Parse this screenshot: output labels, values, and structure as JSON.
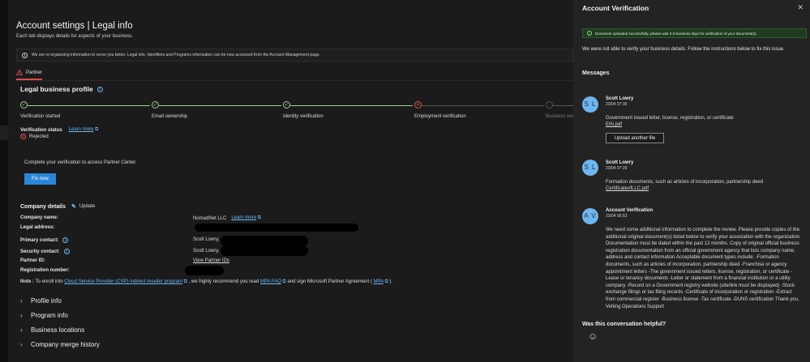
{
  "page": {
    "title": "Account settings | Legal info",
    "subtitle": "Each tab displays details for aspects of your business.",
    "banner": "We are re-organizing information to serve you better. Legal info, Identifiers and Programs information can be now accessed from the Account Management page.",
    "tab": "Partner"
  },
  "profile": {
    "title": "Legal business profile",
    "steps": [
      {
        "label": "Verification started",
        "state": "done"
      },
      {
        "label": "Email ownership",
        "state": "done"
      },
      {
        "label": "Identity verification",
        "state": "done"
      },
      {
        "label": "Employment verification",
        "state": "failed"
      },
      {
        "label": "Business veri",
        "state": "pending"
      }
    ],
    "status_label": "Verification status",
    "learn_more": "Learn more",
    "status_value": "Rejected",
    "complete_text": "Complete your verification to access Partner Center",
    "fix_button": "Fix now"
  },
  "company": {
    "title": "Company details",
    "update": "Update",
    "rows": {
      "name_label": "Company name:",
      "name_value": "NomadNet LLC",
      "name_link": "Learn more",
      "address_label": "Legal address:",
      "primary_label": "Primary contact:",
      "primary_value": "Scott Lowry,",
      "security_label": "Security contact:",
      "security_value": "Scott Lowry,",
      "partner_label": "Partner ID:",
      "partner_link": "View Partner IDs",
      "registration_label": "Registration number:"
    },
    "note": {
      "prefix": "Note :",
      "text1": " To enroll into ",
      "link1": "Cloud Service Provider (CSP) indirect reseller program",
      "text2": " , we highly recommend you read ",
      "link2": "MPA FAQ",
      "text3": " and sign Microsoft Partner Agreement ( ",
      "link3": "MPA",
      "text4": " )."
    }
  },
  "sections": [
    "Profile info",
    "Program info",
    "Business locations",
    "Company merge history"
  ],
  "panel": {
    "title": "Account Verification",
    "success": "Document uploaded successfully, please wait 3-5 business days for verification of your document(s).",
    "not_verified": "We were not able to verify your business details. Follow the instructions below to fix this issue.",
    "messages_heading": "Messages",
    "messages": [
      {
        "initials": "S L",
        "name": "Scott Lowry",
        "time": "23/04 07:30",
        "body": "Government issued letter, license, registration, or certificate",
        "link": "EIN.pdf",
        "button": "Upload another file"
      },
      {
        "initials": "S L",
        "name": "Scott Lowry",
        "time": "23/04 07:29",
        "body": "Formation documents, such as articles of incorporation, partnership deed",
        "link": "CertificateofLLC.pdf"
      },
      {
        "initials": "A V",
        "name": "Account Verification",
        "time": "23/04 06:53",
        "body": "We need some additional information to complete the review. Please provide copies of the additional original document(s) listed below to verify your association with the organization. Documentation must be dated within the past 12 months. Copy of original official business registration documentation from an official government agency that lists company name, address and contact information.Acceptable document types include: -Formation documents, such as articles of incorporation, partnership deed -Franchise or agency appointment letters -The government issued letters, license, registration, or certificate -Lease or tenancy documents -Letter or statement from a financial institution or a utility company -Record on a Government registry website (site/link must be displayed) -Stock exchange filings or tax filing records -Certificate of incorporation or registration -Extract from commercial register -Business license -Tax certificate -DUNS certification Thank you, Vetting Operations Support"
      }
    ],
    "helpful": "Was this conversation helpful?"
  },
  "colors": {
    "accent": "#2a86d8",
    "success": "#9bd18e",
    "error": "#e25555",
    "link": "#6cb8f6",
    "avatar": "#6fb5ee"
  }
}
